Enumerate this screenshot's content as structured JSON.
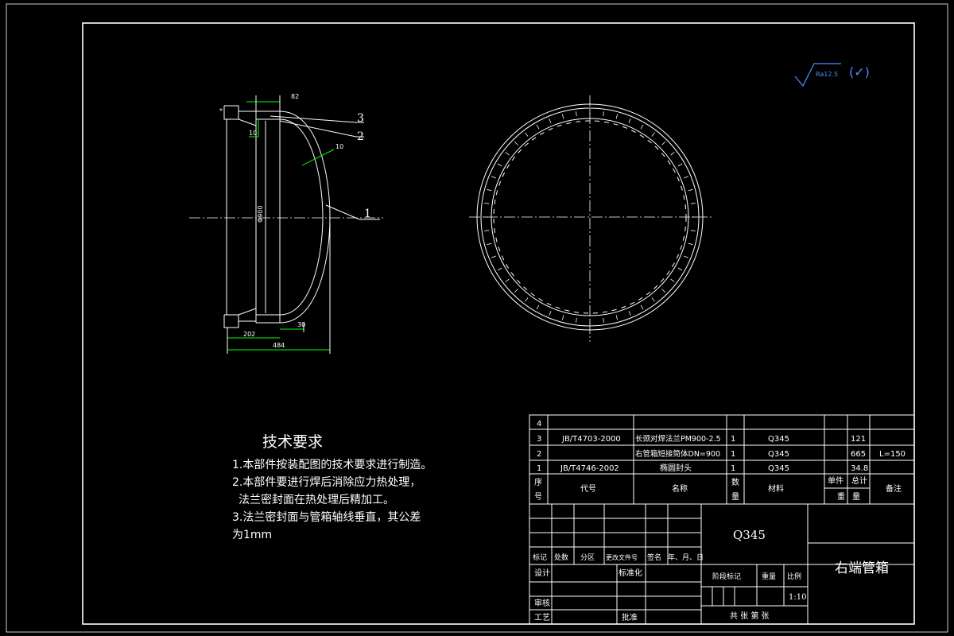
{
  "roughness": {
    "symbol": "Ra12.5",
    "note": "(✓)"
  },
  "side_view": {
    "dims": {
      "top": "82",
      "left_small": "10",
      "thickness": "10",
      "diameter": "Φ900",
      "bottom_left": "202",
      "bottom_right": "30",
      "overall": "484"
    },
    "balloons": [
      "3",
      "2",
      "1"
    ],
    "marker": "*"
  },
  "tech_requirements": {
    "title": "技术要求",
    "lines": [
      "1.本部件按装配图的技术要求进行制造。",
      "2.本部件要进行焊后消除应力热处理，",
      "法兰密封面在热处理后精加工。",
      "3.法兰密封面与管箱轴线垂直，其公差",
      "为1mm"
    ]
  },
  "bom": {
    "rows": [
      {
        "no": "4",
        "code": "",
        "name": "",
        "qty": "",
        "material": "",
        "unit": "",
        "total": "",
        "note": ""
      },
      {
        "no": "3",
        "code": "JB/T4703-2000",
        "name": "长颈对焊法兰PM900-2.5",
        "qty": "1",
        "material": "Q345",
        "unit": "",
        "total": "121",
        "note": ""
      },
      {
        "no": "2",
        "code": "",
        "name": "右管箱短接筒体DN=900",
        "qty": "1",
        "material": "Q345",
        "unit": "",
        "total": "665",
        "note": "L=150"
      },
      {
        "no": "1",
        "code": "JB/T4746-2002",
        "name": "椭圆封头",
        "qty": "1",
        "material": "Q345",
        "unit": "",
        "total": "34.8",
        "note": ""
      }
    ],
    "header": {
      "no": [
        "序",
        "号"
      ],
      "code": "代号",
      "name": "名称",
      "qty": [
        "数",
        "量"
      ],
      "material": "材料",
      "unit": "单件",
      "total": "总计",
      "weight": [
        "重",
        "量"
      ],
      "note": "备注"
    }
  },
  "title_block": {
    "material": "Q345",
    "drawing_name": "右端管箱",
    "change_row": [
      "标记",
      "处数",
      "分区",
      "更改文件号",
      "签名",
      "年、月、日"
    ],
    "design": "设计",
    "standardize": "标准化",
    "review": "审核",
    "process": "工艺",
    "approve": "批准",
    "stage_mark": "阶段标记",
    "weight": "重量",
    "scale_label": "比例",
    "scale": "1:10",
    "sheets": "共 张 第 张"
  }
}
